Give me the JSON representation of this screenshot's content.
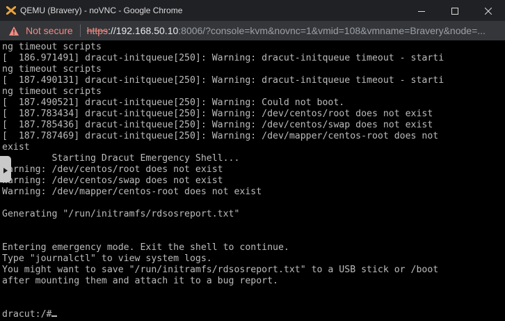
{
  "window": {
    "title": "QEMU (Bravery) - noVNC - Google Chrome",
    "colors": {
      "titlebar": "#202124",
      "addressbar": "#35363a",
      "warning": "#f28b82",
      "brand_icon": "#e8a33d"
    }
  },
  "addressbar": {
    "security_label": "Not secure",
    "url_scheme": "https",
    "url_host": "://192.168.50.10",
    "url_rest": ":8006/?console=kvm&novnc=1&vmid=108&vmname=Bravery&node=..."
  },
  "console": {
    "lines": [
      "ng timeout scripts",
      "[  186.971491] dracut-initqueue[250]: Warning: dracut-initqueue timeout - starti",
      "ng timeout scripts",
      "[  187.490131] dracut-initqueue[250]: Warning: dracut-initqueue timeout - starti",
      "ng timeout scripts",
      "[  187.490521] dracut-initqueue[250]: Warning: Could not boot.",
      "[  187.783434] dracut-initqueue[250]: Warning: /dev/centos/root does not exist",
      "[  187.785436] dracut-initqueue[250]: Warning: /dev/centos/swap does not exist",
      "[  187.787469] dracut-initqueue[250]: Warning: /dev/mapper/centos-root does not",
      "exist",
      "         Starting Dracut Emergency Shell...",
      "Warning: /dev/centos/root does not exist",
      "Warning: /dev/centos/swap does not exist",
      "Warning: /dev/mapper/centos-root does not exist",
      "",
      "Generating \"/run/initramfs/rdsosreport.txt\"",
      "",
      "",
      "Entering emergency mode. Exit the shell to continue.",
      "Type \"journalctl\" to view system logs.",
      "You might want to save \"/run/initramfs/rdsosreport.txt\" to a USB stick or /boot",
      "after mounting them and attach it to a bug report.",
      "",
      "",
      "dracut:/#"
    ]
  }
}
